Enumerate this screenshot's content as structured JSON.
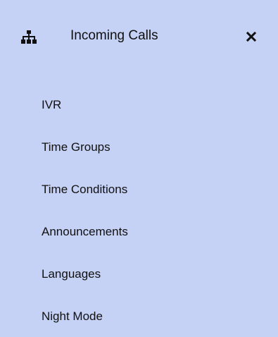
{
  "header": {
    "icon": "sitemap-icon",
    "title": "Incoming Calls",
    "close_icon": "close-icon"
  },
  "menu": {
    "items": [
      {
        "label": "IVR"
      },
      {
        "label": "Time Groups"
      },
      {
        "label": "Time Conditions"
      },
      {
        "label": "Announcements"
      },
      {
        "label": "Languages"
      },
      {
        "label": "Night Mode"
      }
    ]
  },
  "colors": {
    "background": "#c5d1f5",
    "text": "#111111"
  }
}
